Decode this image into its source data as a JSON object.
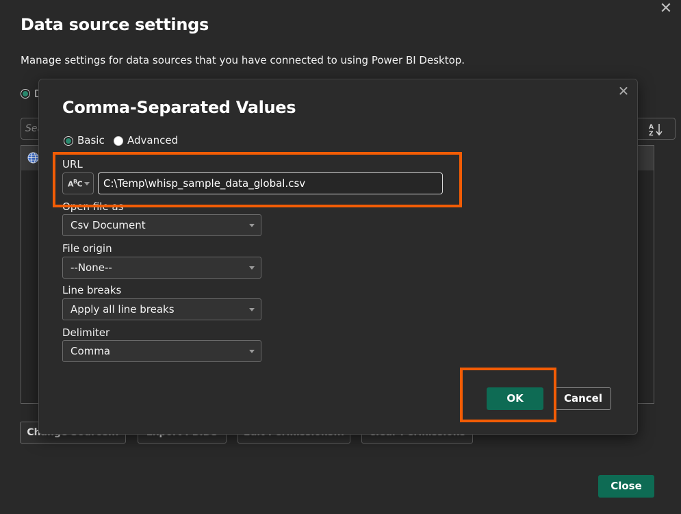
{
  "outer_dialog": {
    "title": "Data source settings",
    "description": "Manage settings for data sources that you have connected to using Power BI Desktop.",
    "radio_label_partial": "D",
    "search_placeholder_partial": "Sea",
    "buttons": [
      "Change Source...",
      "Export PBIDS",
      "Edit Permissions...",
      "Clear Permissions"
    ],
    "close_label": "Close"
  },
  "modal": {
    "title": "Comma-Separated Values",
    "mode_options": {
      "basic": "Basic",
      "advanced": "Advanced",
      "selected": "Basic"
    },
    "url": {
      "label": "URL",
      "type_icon": "abc-text-icon",
      "value": "C:\\Temp\\whisp_sample_data_global.csv"
    },
    "open_file_as": {
      "label": "Open file as",
      "value": "Csv Document"
    },
    "file_origin": {
      "label": "File origin",
      "value": "--None--"
    },
    "line_breaks": {
      "label": "Line breaks",
      "value": "Apply all line breaks"
    },
    "delimiter": {
      "label": "Delimiter",
      "value": "Comma"
    },
    "ok_label": "OK",
    "cancel_label": "Cancel"
  },
  "colors": {
    "accent": "#0e6b54",
    "highlight": "#f25c05",
    "background": "#292929",
    "modal_background": "#2b2b2b"
  }
}
